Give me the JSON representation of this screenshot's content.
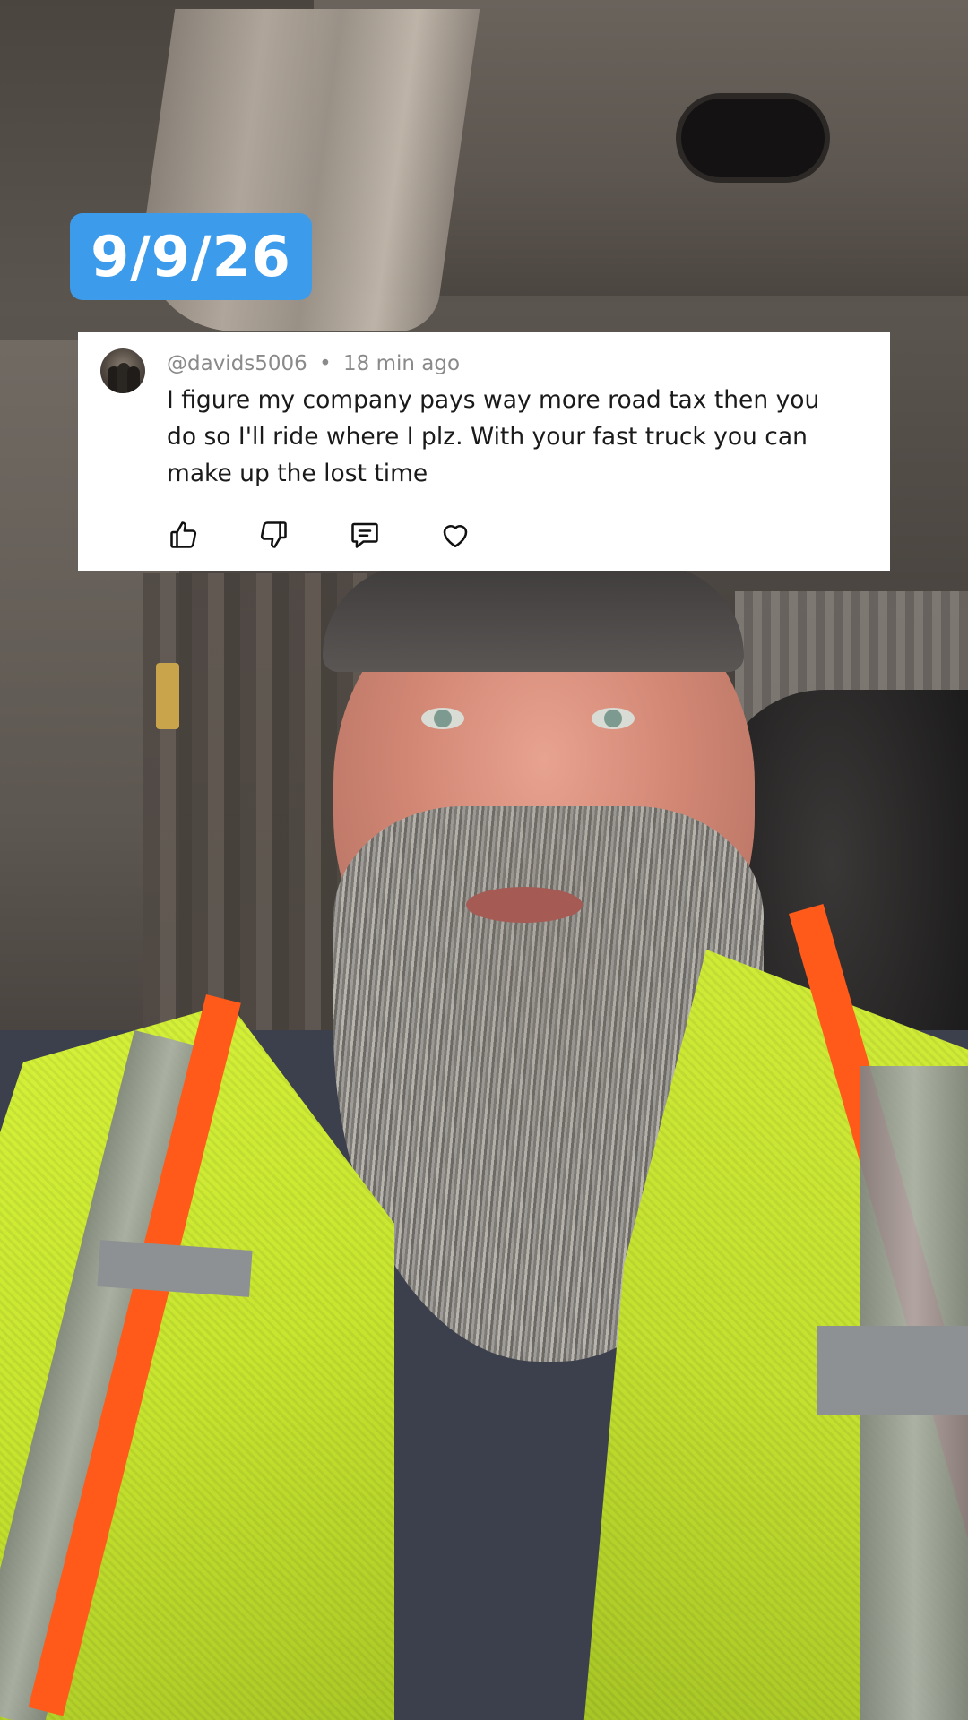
{
  "overlay": {
    "date_label": "9/9/26"
  },
  "comment": {
    "username": "@davids5006",
    "separator": "•",
    "time_ago": "18 min ago",
    "text": "I figure my company pays way more road tax then you do so I'll ride where I plz. With your fast truck you can make up the lost time"
  },
  "actions": {
    "icons": [
      "thumbs-up-icon",
      "thumbs-down-icon",
      "reply-icon",
      "heart-icon"
    ]
  },
  "colors": {
    "date_badge_bg": "#3d9bec",
    "card_bg": "#ffffff",
    "meta_text": "#8a8a8a",
    "body_text": "#1a1a1a"
  }
}
